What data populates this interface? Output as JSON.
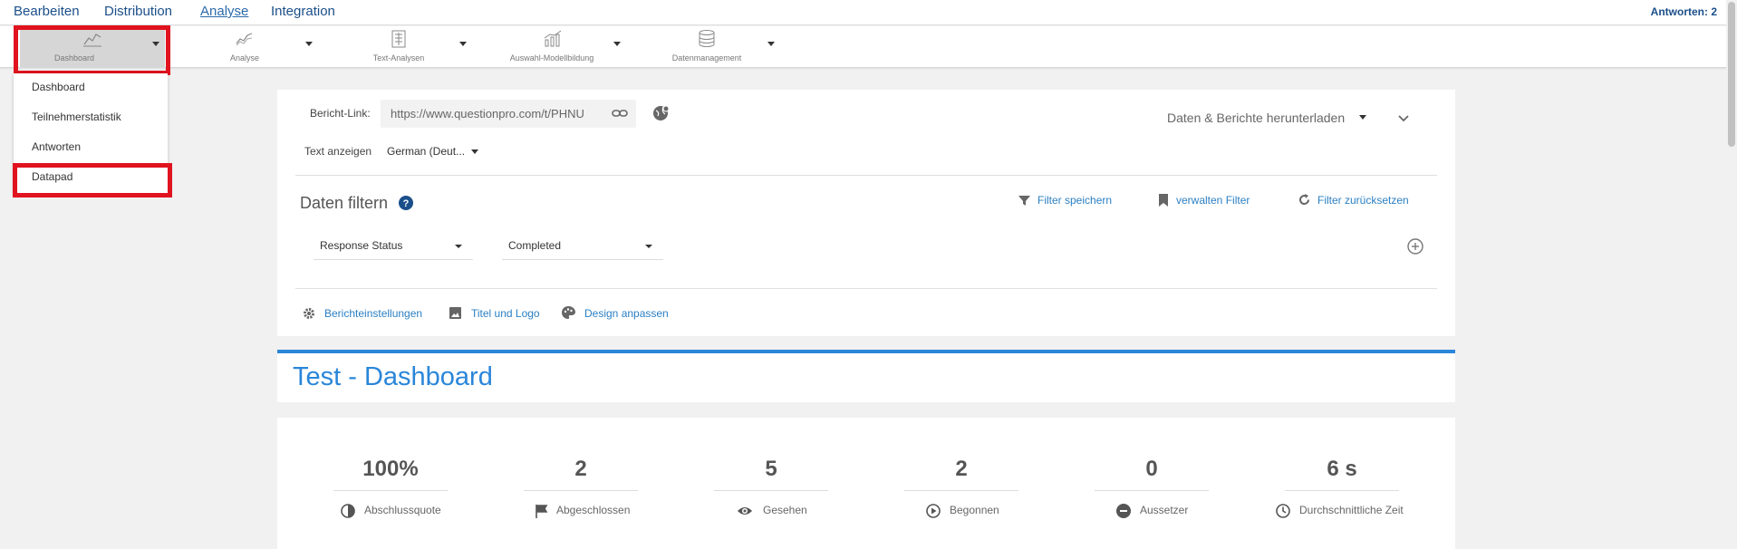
{
  "topnav": {
    "items": [
      "Bearbeiten",
      "Distribution",
      "Analyse",
      "Integration"
    ],
    "responses": "Antworten: 2"
  },
  "toolbar": {
    "tools": [
      {
        "label": "Dashboard",
        "icon": "line-chart-icon"
      },
      {
        "label": "Analyse",
        "icon": "trend-chart-icon"
      },
      {
        "label": "Text-Analysen",
        "icon": "text-grid-icon"
      },
      {
        "label": "Auswahl-Modellbildung",
        "icon": "bar-trend-icon"
      },
      {
        "label": "Datenmanagement",
        "icon": "database-icon"
      }
    ]
  },
  "dropdown": {
    "items": [
      "Dashboard",
      "Teilnehmerstatistik",
      "Antworten",
      "Datapad"
    ]
  },
  "report": {
    "link_label": "Bericht-Link:",
    "link_value": "https://www.questionpro.com/t/PHNU",
    "download_label": "Daten & Berichte herunterladen",
    "text_show_label": "Text anzeigen",
    "language": "German (Deut..."
  },
  "filter": {
    "title": "Daten filtern",
    "save": "Filter speichern",
    "manage": "verwalten Filter",
    "reset": "Filter zurücksetzen",
    "field": "Response Status",
    "value": "Completed"
  },
  "settings": {
    "report_settings": "Berichteinstellungen",
    "title_logo": "Titel und Logo",
    "design": "Design anpassen"
  },
  "dashboard_title": "Test - Dashboard",
  "stats": [
    {
      "value": "100%",
      "label": "Abschlussquote",
      "icon": "pie-icon"
    },
    {
      "value": "2",
      "label": "Abgeschlossen",
      "icon": "flag-icon"
    },
    {
      "value": "5",
      "label": "Gesehen",
      "icon": "eye-icon"
    },
    {
      "value": "2",
      "label": "Begonnen",
      "icon": "play-icon"
    },
    {
      "value": "0",
      "label": "Aussetzer",
      "icon": "minus-circle-icon"
    },
    {
      "value": "6 s",
      "label": "Durchschnittliche Zeit",
      "icon": "clock-icon"
    }
  ],
  "colors": {
    "accent": "#2a86d9",
    "highlight": "#e0131f",
    "nav": "#1b4f8a"
  }
}
